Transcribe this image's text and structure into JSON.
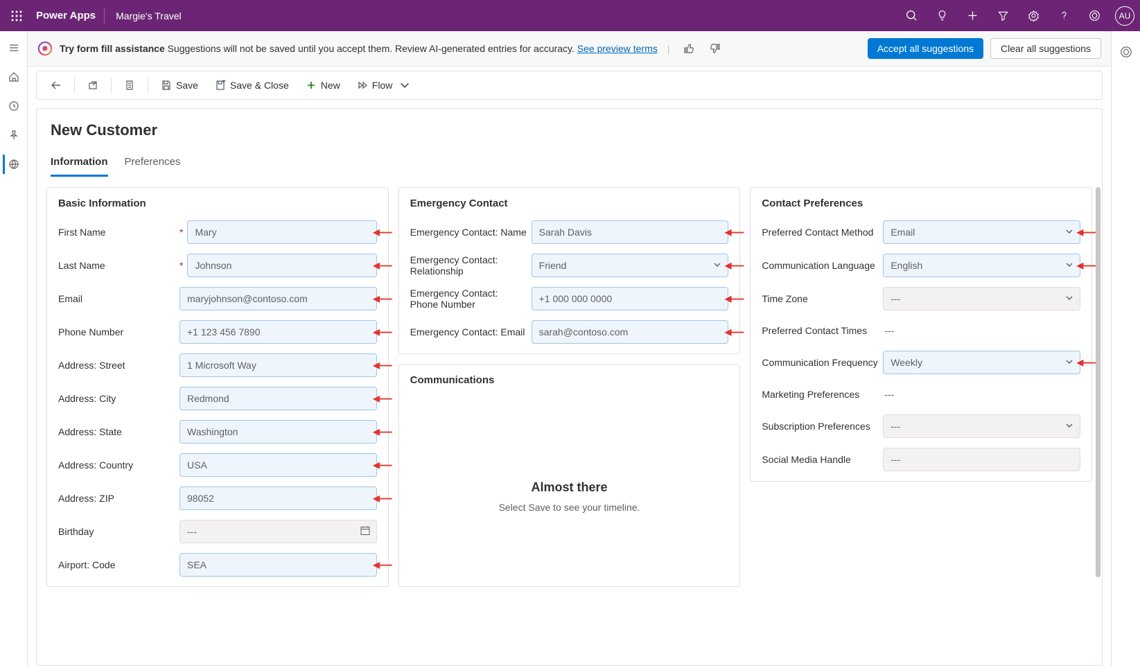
{
  "topbar": {
    "app_title": "Power Apps",
    "env_name": "Margie's Travel",
    "avatar_initials": "AU"
  },
  "banner": {
    "bold": "Try form fill assistance",
    "text": " Suggestions will not be saved until you accept them. Review AI-generated entries for accuracy. ",
    "link": "See preview terms",
    "accept_btn": "Accept all suggestions",
    "clear_btn": "Clear all suggestions"
  },
  "commands": {
    "save": "Save",
    "save_close": "Save & Close",
    "new": "New",
    "flow": "Flow"
  },
  "record": {
    "title": "New Customer",
    "tabs": [
      "Information",
      "Preferences"
    ]
  },
  "sections": {
    "basic": {
      "title": "Basic Information",
      "fields": {
        "first_name": {
          "label": "First Name",
          "value": "Mary",
          "required": true,
          "suggested": true
        },
        "last_name": {
          "label": "Last Name",
          "value": "Johnson",
          "required": true,
          "suggested": true
        },
        "email": {
          "label": "Email",
          "value": "maryjohnson@contoso.com",
          "suggested": true
        },
        "phone": {
          "label": "Phone Number",
          "value": "+1 123 456 7890",
          "suggested": true
        },
        "street": {
          "label": "Address: Street",
          "value": "1 Microsoft Way",
          "suggested": true
        },
        "city": {
          "label": "Address: City",
          "value": "Redmond",
          "suggested": true
        },
        "state": {
          "label": "Address: State",
          "value": "Washington",
          "suggested": true
        },
        "country": {
          "label": "Address: Country",
          "value": "USA",
          "suggested": true
        },
        "zip": {
          "label": "Address: ZIP",
          "value": "98052",
          "suggested": true
        },
        "birthday": {
          "label": "Birthday",
          "value": "---",
          "suggested": false
        },
        "airport": {
          "label": "Airport: Code",
          "value": "SEA",
          "suggested": true
        }
      }
    },
    "emergency": {
      "title": "Emergency Contact",
      "fields": {
        "ec_name": {
          "label": "Emergency Contact: Name",
          "value": "Sarah Davis",
          "suggested": true
        },
        "ec_rel": {
          "label": "Emergency Contact: Relationship",
          "value": "Friend",
          "suggested": true
        },
        "ec_phone": {
          "label": "Emergency Contact: Phone Number",
          "value": "+1 000 000 0000",
          "suggested": true
        },
        "ec_email": {
          "label": "Emergency Contact: Email",
          "value": "sarah@contoso.com",
          "suggested": true
        }
      }
    },
    "comms": {
      "title": "Communications",
      "empty_title": "Almost there",
      "empty_sub": "Select Save to see your timeline."
    },
    "prefs": {
      "title": "Contact Preferences",
      "fields": {
        "method": {
          "label": "Preferred Contact Method",
          "value": "Email",
          "suggested": true
        },
        "lang": {
          "label": "Communication Language",
          "value": "English",
          "suggested": true
        },
        "tz": {
          "label": "Time Zone",
          "value": "---",
          "suggested": false
        },
        "times": {
          "label": "Preferred Contact Times",
          "value": "---",
          "suggested": false
        },
        "freq": {
          "label": "Communication Frequency",
          "value": "Weekly",
          "suggested": true
        },
        "marketing": {
          "label": "Marketing Preferences",
          "value": "---",
          "suggested": false
        },
        "subs": {
          "label": "Subscription Preferences",
          "value": "---",
          "suggested": false
        },
        "social": {
          "label": "Social Media Handle",
          "value": "---",
          "suggested": false
        }
      }
    }
  }
}
